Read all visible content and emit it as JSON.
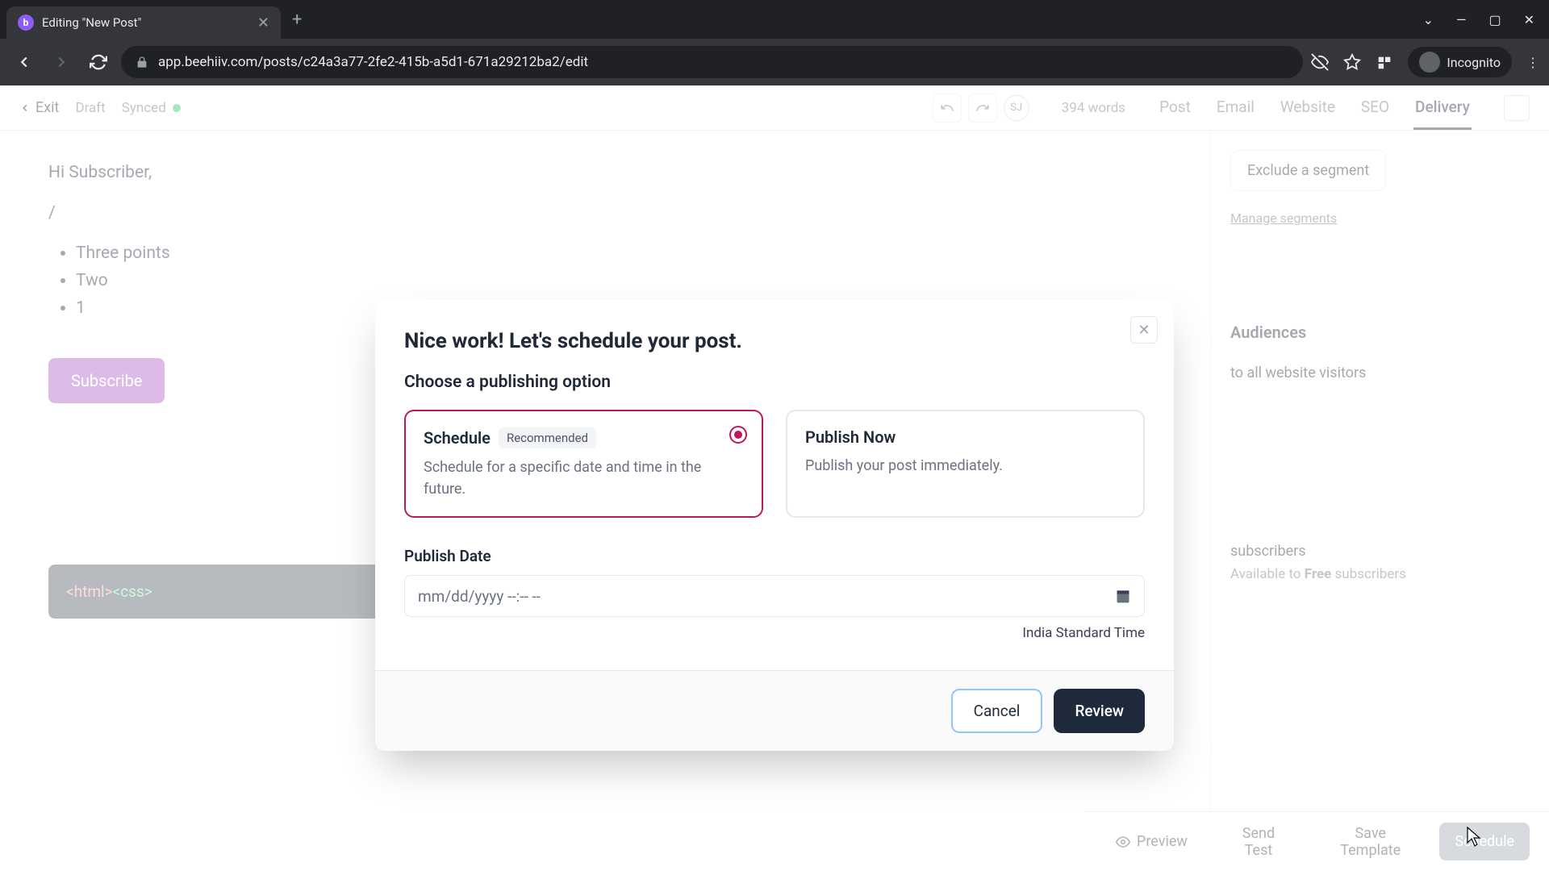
{
  "browser": {
    "tab_title": "Editing \"New Post\"",
    "url": "app.beehiiv.com/posts/c24a3a77-2fe2-415b-a5d1-671a29212ba2/edit",
    "incognito_label": "Incognito"
  },
  "header": {
    "exit": "Exit",
    "draft": "Draft",
    "synced": "Synced",
    "initials": "SJ",
    "word_count": "394 words",
    "tabs": [
      "Post",
      "Email",
      "Website",
      "SEO",
      "Delivery"
    ],
    "active_tab": "Delivery"
  },
  "editor": {
    "greeting": "Hi Subscriber,",
    "slash": "/",
    "bullets": [
      "Three points",
      "Two",
      "1"
    ],
    "subscribe": "Subscribe",
    "code": "<html><css>"
  },
  "sidebar": {
    "exclude": "Exclude a segment",
    "manage": "Manage segments",
    "audiences_h": "Audiences",
    "visitors": "to all website visitors",
    "subscribers": "subscribers",
    "available_pre": "Available to ",
    "available_strong": "Free",
    "available_post": " subscribers"
  },
  "footer": {
    "preview": "Preview",
    "send_test": "Send Test",
    "save_template": "Save Template",
    "schedule": "Schedule"
  },
  "modal": {
    "title": "Nice work! Let's schedule your post.",
    "subtitle": "Choose a publishing option",
    "opt1_title": "Schedule",
    "opt1_badge": "Recommended",
    "opt1_desc": "Schedule for a specific date and time in the future.",
    "opt2_title": "Publish Now",
    "opt2_desc": "Publish your post immediately.",
    "date_label": "Publish Date",
    "date_placeholder": "mm/dd/yyyy --:-- --",
    "timezone": "India Standard Time",
    "cancel": "Cancel",
    "review": "Review"
  }
}
